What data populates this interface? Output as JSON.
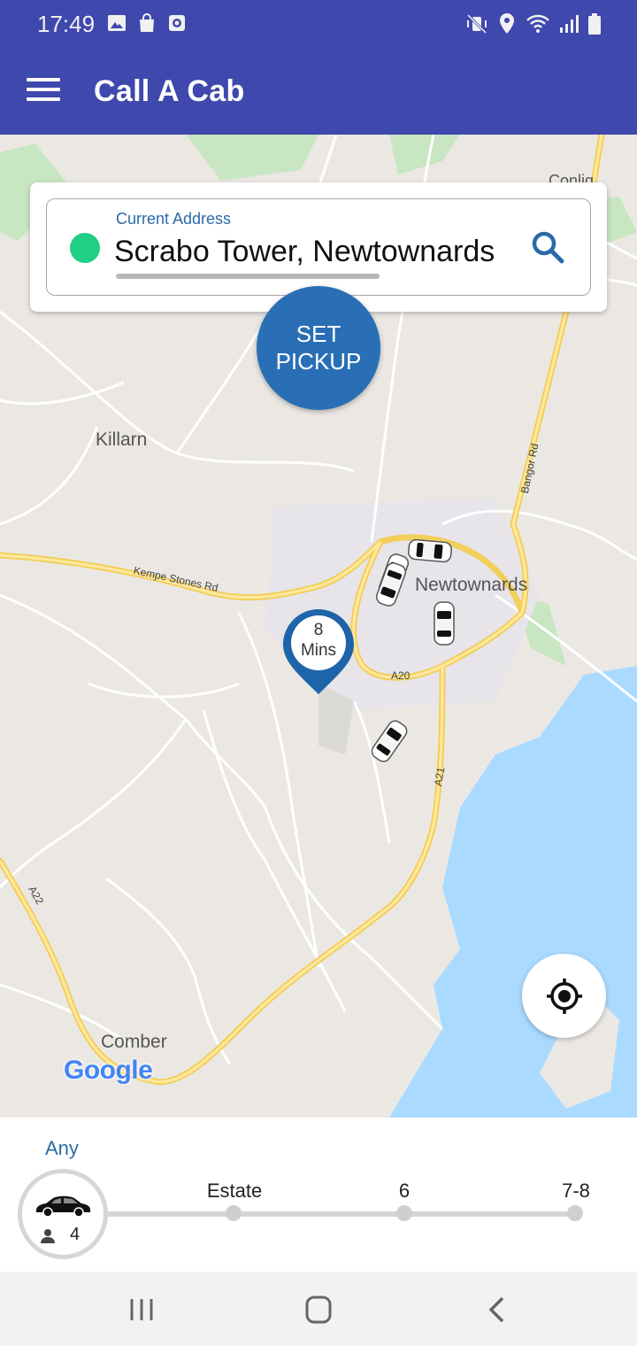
{
  "status_bar": {
    "time": "17:49",
    "left_icons": [
      "gallery-icon",
      "shopping-bag-icon",
      "screen-record-icon"
    ],
    "right_icons": [
      "mute-vibrate-icon",
      "location-icon",
      "wifi-icon",
      "signal-icon",
      "battery-icon"
    ]
  },
  "app_bar": {
    "title": "Call A Cab",
    "menu_icon": "hamburger-menu-icon"
  },
  "address": {
    "label": "Current Address",
    "value": "Scrabo Tower, Newtownards",
    "search_icon": "search-icon"
  },
  "set_pickup": {
    "label_line1": "SET",
    "label_line2": "PICKUP"
  },
  "eta_marker": {
    "value": "8",
    "unit": "Mins"
  },
  "map": {
    "places": {
      "killarn": "Killarn",
      "newtownards": "Newtownards",
      "comber": "Comber",
      "conlig": "Conlig"
    },
    "roads": {
      "kempe": "Kempe Stones Rd",
      "bangor": "Bangor Rd",
      "a20": "A20",
      "a21": "A21",
      "a22": "A22"
    },
    "attribution": "Google",
    "colors": {
      "land": "#ebe8e4",
      "water": "#aadaff",
      "road_major": "#f7d86c",
      "road_minor": "#ffffff",
      "park": "#c8e6c1"
    }
  },
  "vehicle_selector": {
    "selected_label": "Any",
    "selected_seats": "4",
    "options": [
      {
        "label": "Estate"
      },
      {
        "label": "6"
      },
      {
        "label": "7-8"
      }
    ]
  },
  "colors": {
    "primary": "#3f48ad",
    "accent": "#2a6fb6",
    "green_dot": "#1fcf86"
  }
}
